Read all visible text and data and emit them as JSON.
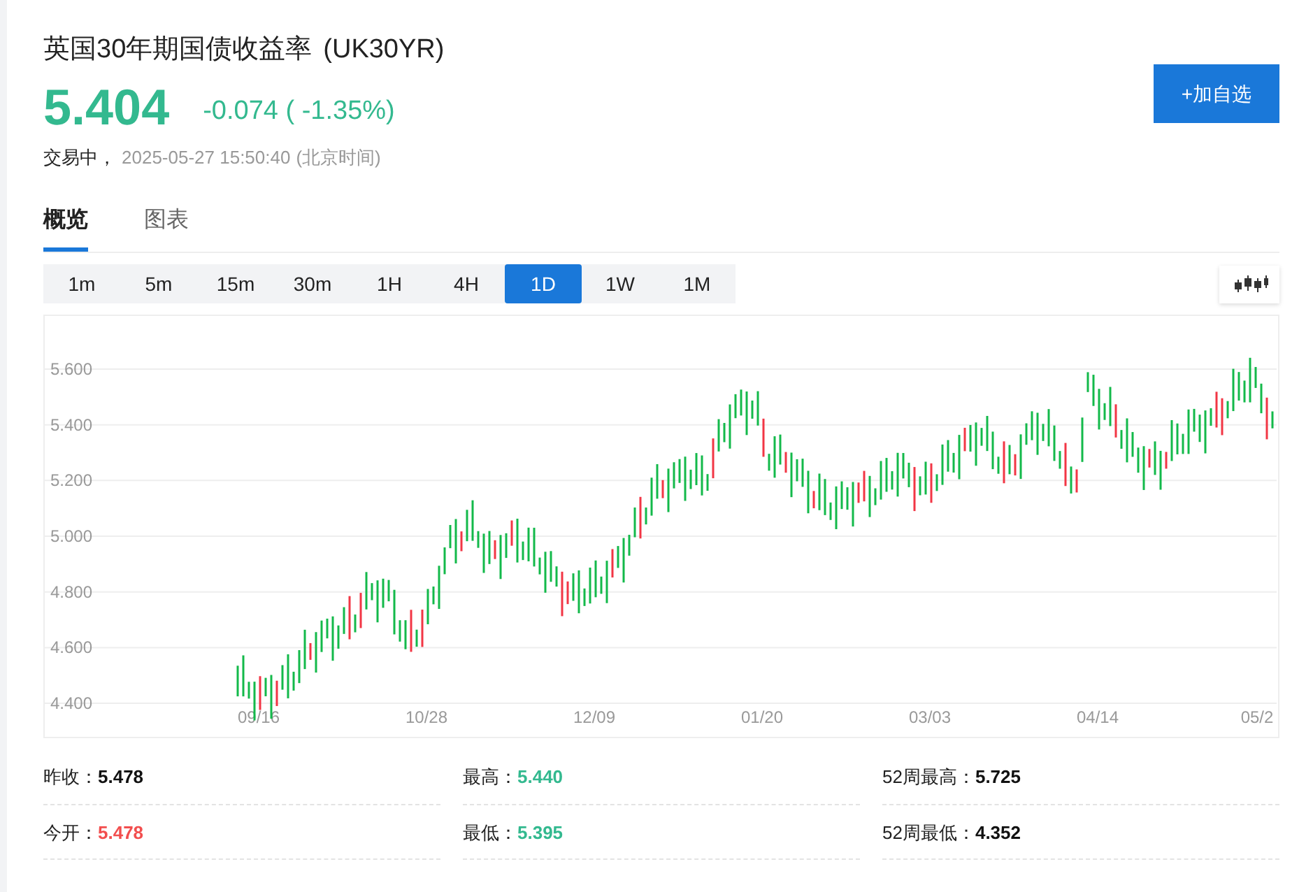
{
  "header": {
    "title": "英国30年期国债收益率",
    "symbol": "(UK30YR)",
    "price": "5.404",
    "change": "-0.074 ( -1.35%)",
    "status": "交易中，",
    "timestamp": "2025-05-27 15:50:40",
    "timezone": "(北京时间)"
  },
  "watch_button": "+加自选",
  "tabs": [
    {
      "label": "概览",
      "selected": true
    },
    {
      "label": "图表",
      "selected": false
    }
  ],
  "timeframes": [
    {
      "label": "1m",
      "selected": false
    },
    {
      "label": "5m",
      "selected": false
    },
    {
      "label": "15m",
      "selected": false
    },
    {
      "label": "30m",
      "selected": false
    },
    {
      "label": "1H",
      "selected": false
    },
    {
      "label": "4H",
      "selected": false
    },
    {
      "label": "1D",
      "selected": true
    },
    {
      "label": "1W",
      "selected": false
    },
    {
      "label": "1M",
      "selected": false
    }
  ],
  "chart": {
    "y_labels": [
      "5.600",
      "5.400",
      "5.200",
      "5.000",
      "4.800",
      "4.600",
      "4.400"
    ],
    "x_labels": [
      "09/16",
      "10/28",
      "12/09",
      "01/20",
      "03/03",
      "04/14",
      "05/2"
    ]
  },
  "stats": [
    {
      "label": "昨收：",
      "value": "5.478",
      "color": "#111111"
    },
    {
      "label": "最高：",
      "value": "5.440",
      "color": "#33b98f"
    },
    {
      "label": "52周最高：",
      "value": "5.725",
      "color": "#111111"
    },
    {
      "label": "今开：",
      "value": "5.478",
      "color": "#f24e4e"
    },
    {
      "label": "最低：",
      "value": "5.395",
      "color": "#33b98f"
    },
    {
      "label": "52周最低：",
      "value": "4.352",
      "color": "#111111"
    }
  ]
}
